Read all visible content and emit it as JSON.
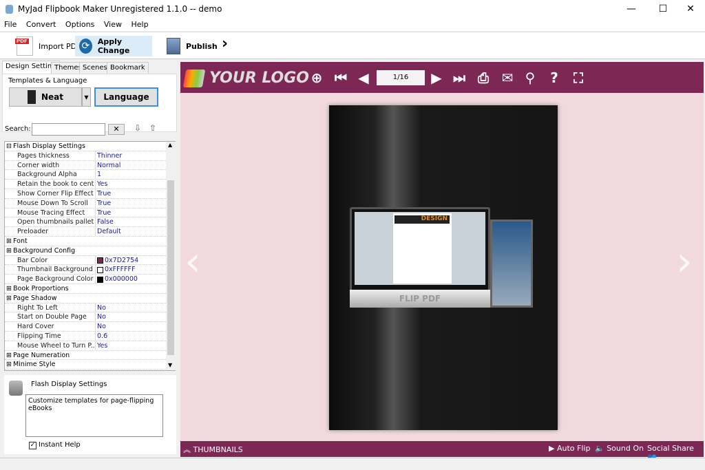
{
  "window": {
    "title": "MyJad Flipbook Maker Unregistered 1.1.0  -- demo",
    "minimize": "—",
    "maximize": "☐",
    "close": "✕"
  },
  "menu": [
    "File",
    "Convert",
    "Options",
    "View",
    "Help"
  ],
  "toolbar": {
    "import_pdf": "Import PDF",
    "apply_change": "Apply Change",
    "publish": "Publish",
    "more": "›",
    "pdf_badge": "PDF"
  },
  "left": {
    "tabs": [
      "Design Setting",
      "Themes",
      "Scenes",
      "Bookmark"
    ],
    "templates_label": "Templates & Language",
    "template_value": "Neat",
    "language_button": "Language",
    "search_label": "Search:",
    "search_value": "",
    "properties": [
      {
        "name": "Flash Display Settings",
        "value": "",
        "category": true,
        "expanded": true
      },
      {
        "name": "Pages thickness",
        "value": "Thinner"
      },
      {
        "name": "Corner width",
        "value": "Normal"
      },
      {
        "name": "Background Alpha",
        "value": "1"
      },
      {
        "name": "Retain the book to center",
        "value": "Yes"
      },
      {
        "name": "Show Corner Flip Effect",
        "value": "True"
      },
      {
        "name": "Mouse Down To Scroll",
        "value": "True"
      },
      {
        "name": "Mouse Tracing Effect",
        "value": "True"
      },
      {
        "name": "Open thumbnails pallet",
        "value": "False"
      },
      {
        "name": "Preloader",
        "value": "Default"
      },
      {
        "name": "Font",
        "value": "",
        "category": true
      },
      {
        "name": "Background Config",
        "value": "",
        "category": true
      },
      {
        "name": "Bar Color",
        "value": "0x7D2754",
        "swatch": "#7D2754"
      },
      {
        "name": "Thumbnail Background ...",
        "value": "0xFFFFFF",
        "swatch": "#FFFFFF"
      },
      {
        "name": "Page Background Color",
        "value": "0x000000",
        "swatch": "#000000"
      },
      {
        "name": "Book Proportions",
        "value": "",
        "category": true
      },
      {
        "name": "Page Shadow",
        "value": "",
        "category": true
      },
      {
        "name": "Right To Left",
        "value": "No"
      },
      {
        "name": "Start on Double Page",
        "value": "No"
      },
      {
        "name": "Hard Cover",
        "value": "No"
      },
      {
        "name": "Flipping Time",
        "value": "0.6"
      },
      {
        "name": "Mouse Wheel to Turn P...",
        "value": "Yes"
      },
      {
        "name": "Page Numeration",
        "value": "",
        "category": true
      },
      {
        "name": "Minime Style",
        "value": "",
        "category": true
      }
    ],
    "help": {
      "title": "Flash Display Settings",
      "text": "Customize templates for page-flipping eBooks",
      "instant_help": "Instant Help",
      "instant_help_checked": true
    }
  },
  "viewer": {
    "logo": "YOUR LOGO",
    "page_indicator": "1/16",
    "bar_color": "#7D2754",
    "background": "#F1D9DE",
    "book_caption": "FLIP PDF",
    "book_magazine": "DESIGN",
    "thumbnails": "THUMBNAILS",
    "auto_flip": "Auto Flip",
    "sound_on": "Sound On",
    "social_share": "Social Share"
  }
}
